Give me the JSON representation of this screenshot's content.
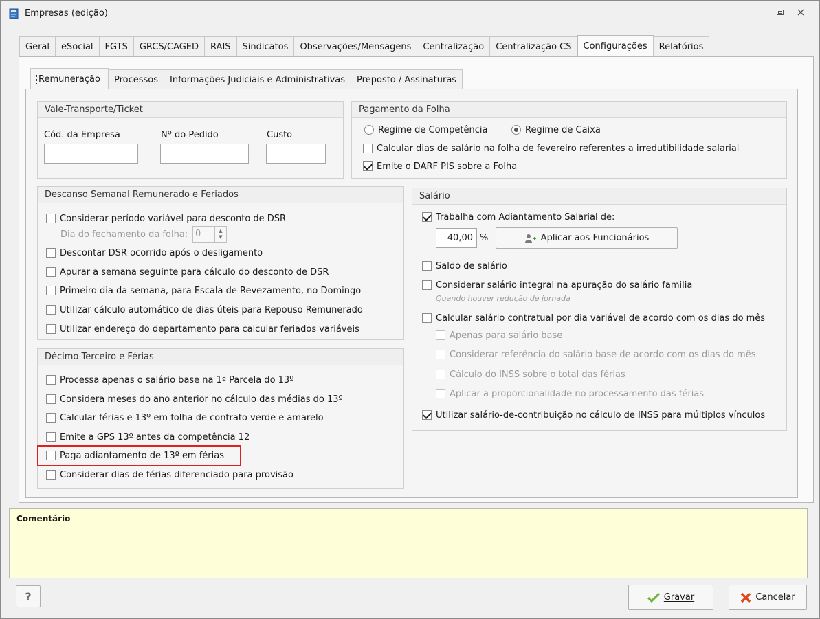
{
  "window": {
    "title": "Empresas (edição)"
  },
  "tabs": [
    {
      "label": "Geral"
    },
    {
      "label": "eSocial"
    },
    {
      "label": "FGTS"
    },
    {
      "label": "GRCS/CAGED"
    },
    {
      "label": "RAIS"
    },
    {
      "label": "Sindicatos"
    },
    {
      "label": "Observações/Mensagens"
    },
    {
      "label": "Centralização"
    },
    {
      "label": "Centralização CS"
    },
    {
      "label": "Configurações"
    },
    {
      "label": "Relatórios"
    }
  ],
  "subtabs": [
    {
      "label": "Remuneração"
    },
    {
      "label": "Processos"
    },
    {
      "label": "Informações Judiciais e Administrativas"
    },
    {
      "label": "Preposto / Assinaturas"
    }
  ],
  "vale": {
    "title": "Vale-Transporte/Ticket",
    "cod_label": "Cód. da Empresa",
    "cod_value": "",
    "pedido_label": "Nº do Pedido",
    "pedido_value": "",
    "custo_label": "Custo",
    "custo_value": ""
  },
  "pagamento": {
    "title": "Pagamento da Folha",
    "radio_competencia": "Regime de Competência",
    "radio_caixa": "Regime de Caixa",
    "cb_fevereiro": "Calcular dias de salário na folha de fevereiro referentes a irredutibilidade salarial",
    "cb_darf": "Emite o DARF PIS sobre a Folha"
  },
  "dsr": {
    "title": "Descanso Semanal Remunerado e Feriados",
    "cb1": "Considerar período variável para desconto de DSR",
    "dia_label": "Dia do fechamento da folha:",
    "dia_value": "0",
    "cb2": "Descontar DSR ocorrido após o desligamento",
    "cb3": "Apurar a semana seguinte para cálculo do desconto de DSR",
    "cb4": "Primeiro dia da semana, para Escala de Revezamento, no Domingo",
    "cb5": "Utilizar cálculo automático de dias úteis para Repouso Remunerado",
    "cb6": "Utilizar endereço do departamento para calcular feriados variáveis"
  },
  "decimo": {
    "title": "Décimo Terceiro e Férias",
    "cb1": "Processa apenas o salário base na 1ª Parcela do 13º",
    "cb2": "Considera meses do ano anterior no cálculo das médias do 13º",
    "cb3": "Calcular férias e 13º em folha de contrato verde e amarelo",
    "cb4": "Emite a GPS 13º antes da competência 12",
    "cb5": "Paga adiantamento de 13º em férias",
    "cb6": "Considerar dias de férias diferenciado para provisão"
  },
  "salario": {
    "title": "Salário",
    "cb_adiantamento": "Trabalha com Adiantamento Salarial de:",
    "percent_value": "40,00",
    "percent_symbol": "%",
    "aplicar_label": "Aplicar aos Funcionários",
    "cb_saldo": "Saldo de salário",
    "cb_integral": "Considerar salário integral na apuração do salário familia",
    "hint_integral": "Quando houver redução de jornada",
    "cb_contratual": "Calcular salário contratual por dia variável de acordo com os dias do mês",
    "sub1": "Apenas para salário base",
    "sub2": "Considerar referência do salário base de acordo com os dias do mês",
    "sub3": "Cálculo do INSS sobre o total das férias",
    "sub4": "Aplicar a proporcionalidade no processamento das férias",
    "cb_contribuicao": "Utilizar salário-de-contribuição no cálculo de INSS para múltiplos vínculos"
  },
  "comment": {
    "label": "Comentário"
  },
  "footer": {
    "help": "?",
    "gravar": "Gravar",
    "cancelar": "Cancelar"
  },
  "colors": {
    "highlight": "#e02020",
    "comment_bg": "#fefed8"
  }
}
